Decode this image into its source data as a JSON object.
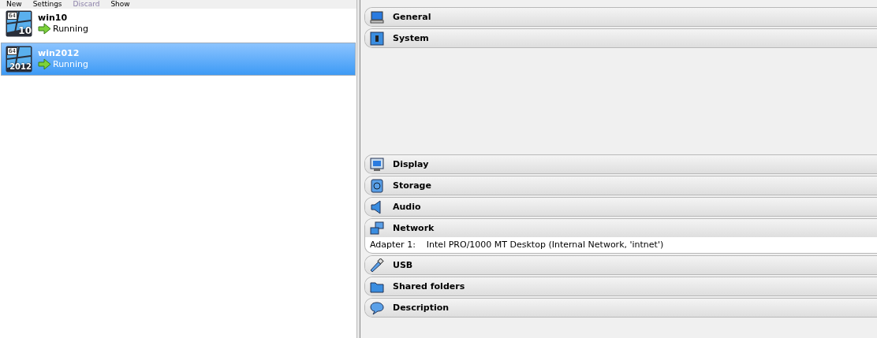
{
  "toolbar": [
    {
      "label": "New",
      "disabled": false
    },
    {
      "label": "Settings",
      "disabled": false
    },
    {
      "label": "Discard",
      "disabled": true
    },
    {
      "label": "Show",
      "disabled": false
    }
  ],
  "vms": [
    {
      "name": "win10",
      "arch": "64",
      "badge": "10",
      "state": "Running",
      "selected": false
    },
    {
      "name": "win2012",
      "arch": "64",
      "badge": "2012",
      "state": "Running",
      "selected": true
    }
  ],
  "sections": [
    {
      "kind": "general",
      "title": "General"
    },
    {
      "kind": "system",
      "title": "System"
    },
    {
      "kind": "display",
      "title": "Display"
    },
    {
      "kind": "storage",
      "title": "Storage"
    },
    {
      "kind": "audio",
      "title": "Audio"
    },
    {
      "kind": "network",
      "title": "Network",
      "details": [
        {
          "label": "Adapter 1:",
          "value": "Intel PRO/1000 MT Desktop (Internal Network, 'intnet')"
        }
      ]
    },
    {
      "kind": "usb",
      "title": "USB"
    },
    {
      "kind": "shared",
      "title": "Shared folders"
    },
    {
      "kind": "description",
      "title": "Description"
    }
  ]
}
